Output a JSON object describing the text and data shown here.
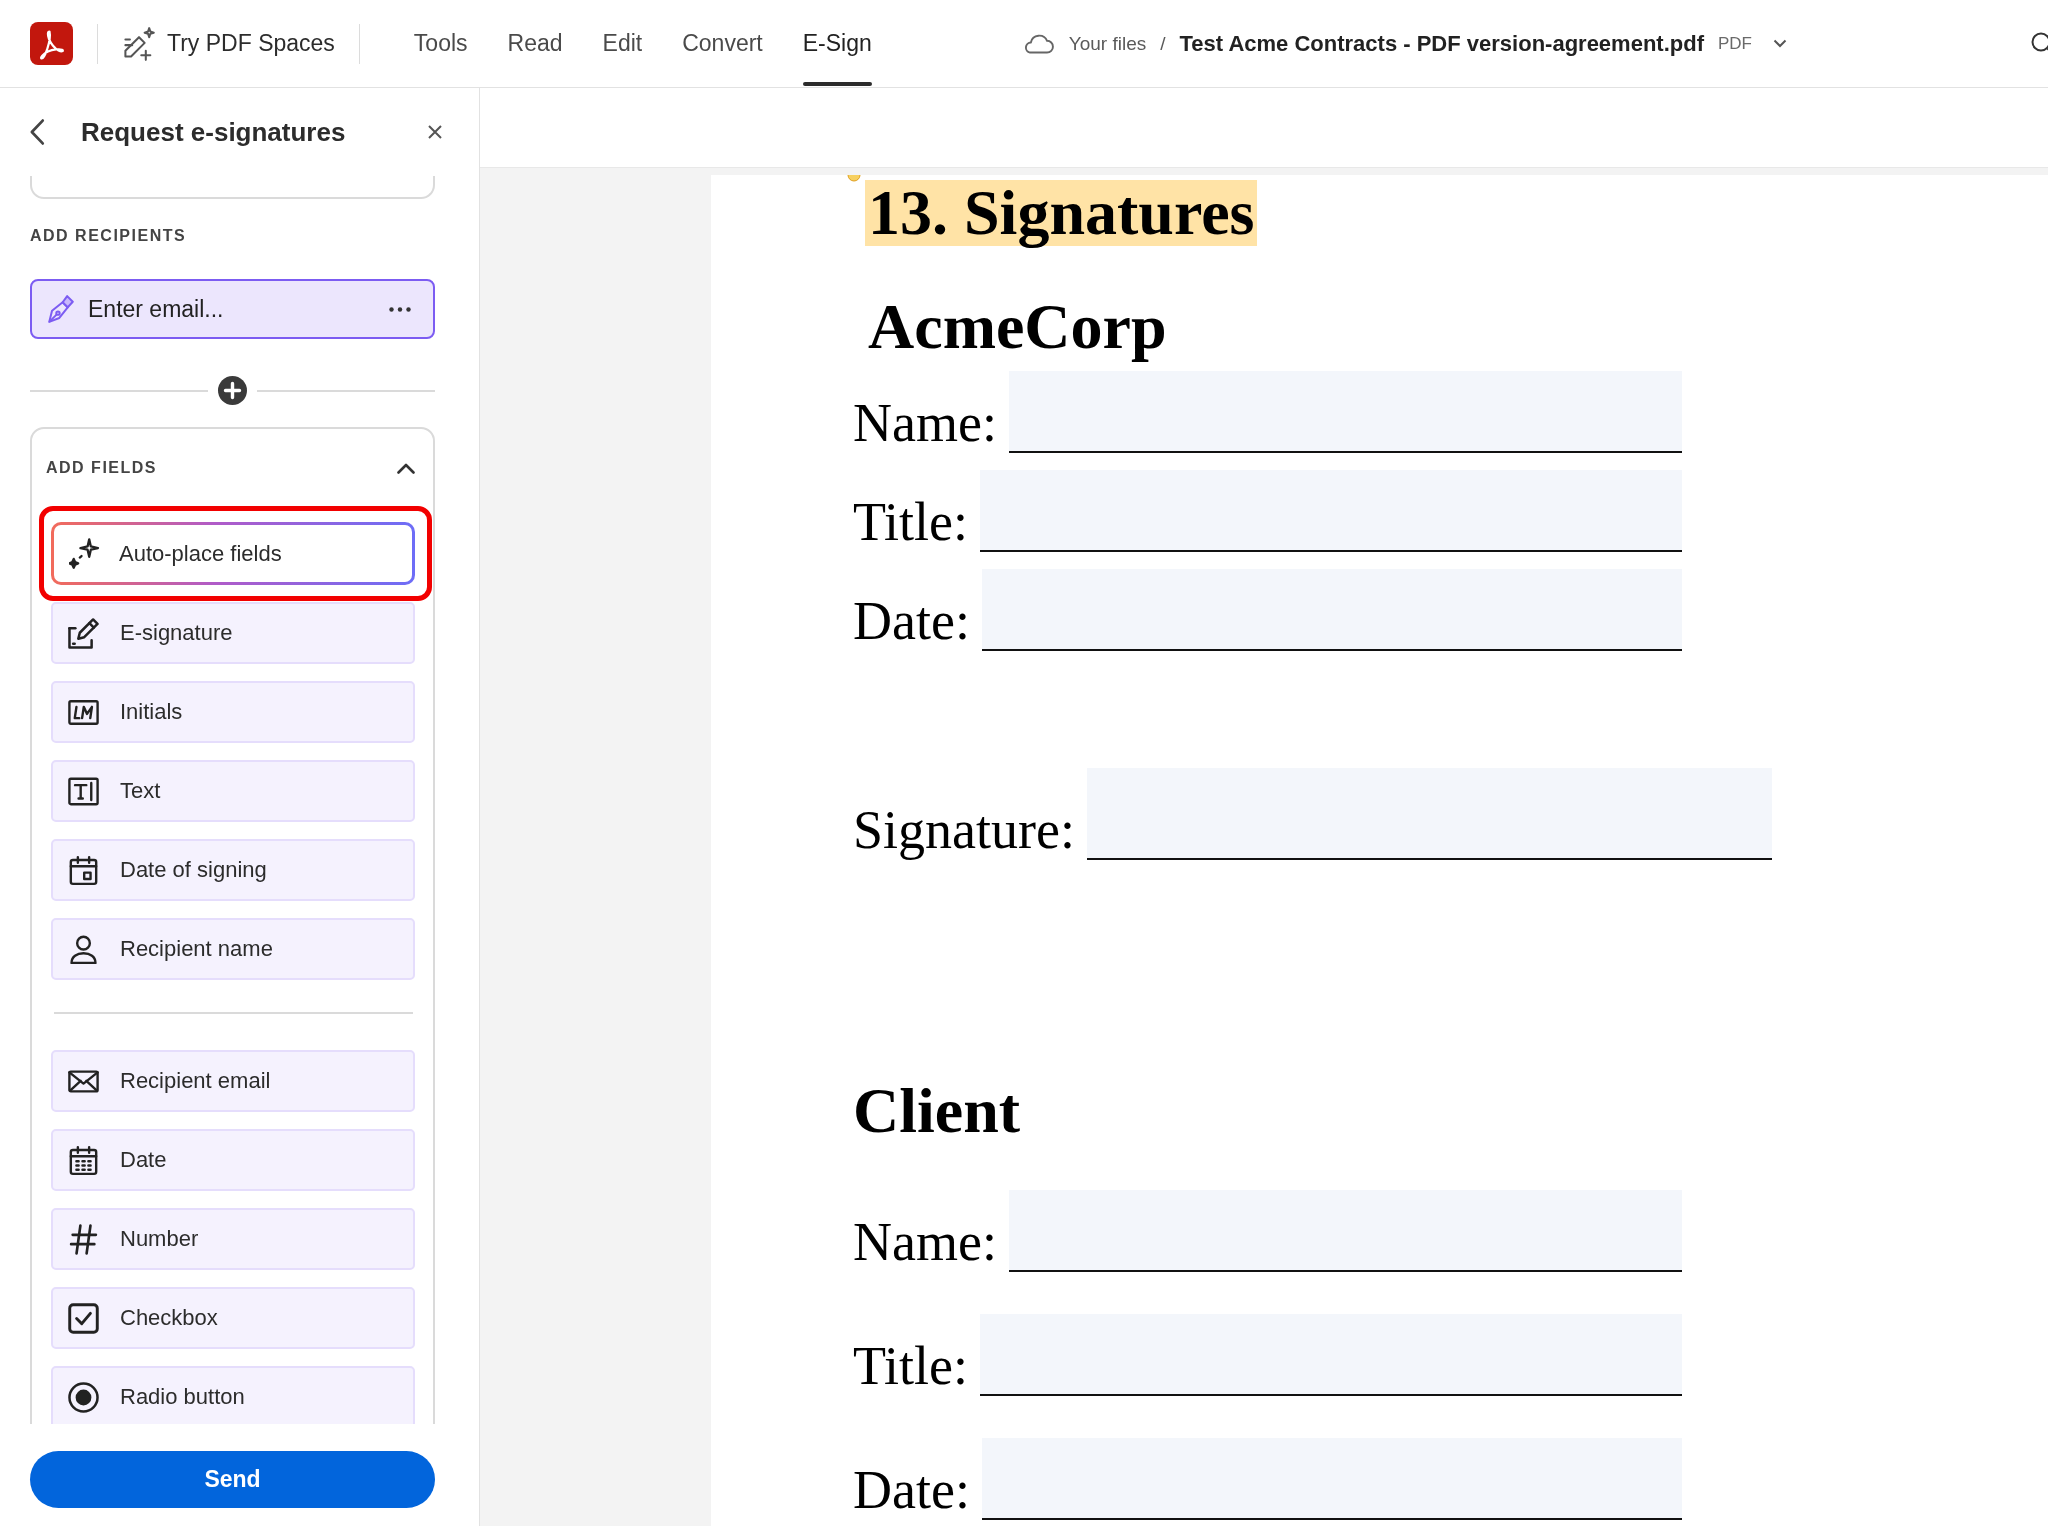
{
  "top_bar": {
    "spaces_button": {
      "label": "Try PDF Spaces"
    },
    "tabs": [
      {
        "label": "Tools",
        "selected": false
      },
      {
        "label": "Read",
        "selected": false
      },
      {
        "label": "Edit",
        "selected": false
      },
      {
        "label": "Convert",
        "selected": false
      },
      {
        "label": "E-Sign",
        "selected": true
      }
    ],
    "breadcrumb": {
      "location": "Your files",
      "separator": "/",
      "file_name": "Test Acme Contracts - PDF version-agreement.pdf",
      "file_type": "PDF"
    }
  },
  "panel": {
    "title": "Request e-signatures",
    "recipients": {
      "heading": "ADD RECIPIENTS",
      "email_field": {
        "placeholder": "Enter email..."
      }
    },
    "fields": {
      "heading": "ADD FIELDS",
      "expanded": true,
      "auto_place": {
        "label": "Auto-place fields",
        "highlighted": true
      },
      "groups": [
        {
          "items": [
            {
              "label": "E-signature",
              "kind": "signature"
            },
            {
              "label": "Initials",
              "kind": "initials"
            },
            {
              "label": "Text",
              "kind": "text"
            },
            {
              "label": "Date of signing",
              "kind": "date_signed"
            },
            {
              "label": "Recipient name",
              "kind": "name"
            }
          ]
        },
        {
          "items": [
            {
              "label": "Recipient email",
              "kind": "email"
            },
            {
              "label": "Date",
              "kind": "date"
            },
            {
              "label": "Number",
              "kind": "number"
            },
            {
              "label": "Checkbox",
              "kind": "checkbox"
            },
            {
              "label": "Radio button",
              "kind": "radio"
            }
          ]
        }
      ]
    },
    "send_button": {
      "label": "Send"
    }
  },
  "document": {
    "heading": {
      "text": "13. Signatures",
      "highlighted": true
    },
    "sections": [
      {
        "title": "AcmeCorp",
        "rows": [
          {
            "label": "Name:",
            "kind": "line"
          },
          {
            "label": "Title:",
            "kind": "line"
          },
          {
            "label": "Date:",
            "kind": "line"
          },
          {
            "label": "Signature:",
            "kind": "signature"
          }
        ]
      },
      {
        "title": "Client",
        "rows": [
          {
            "label": "Name:",
            "kind": "line"
          },
          {
            "label": "Title:",
            "kind": "line"
          },
          {
            "label": "Date:",
            "kind": "line"
          }
        ]
      }
    ]
  }
}
